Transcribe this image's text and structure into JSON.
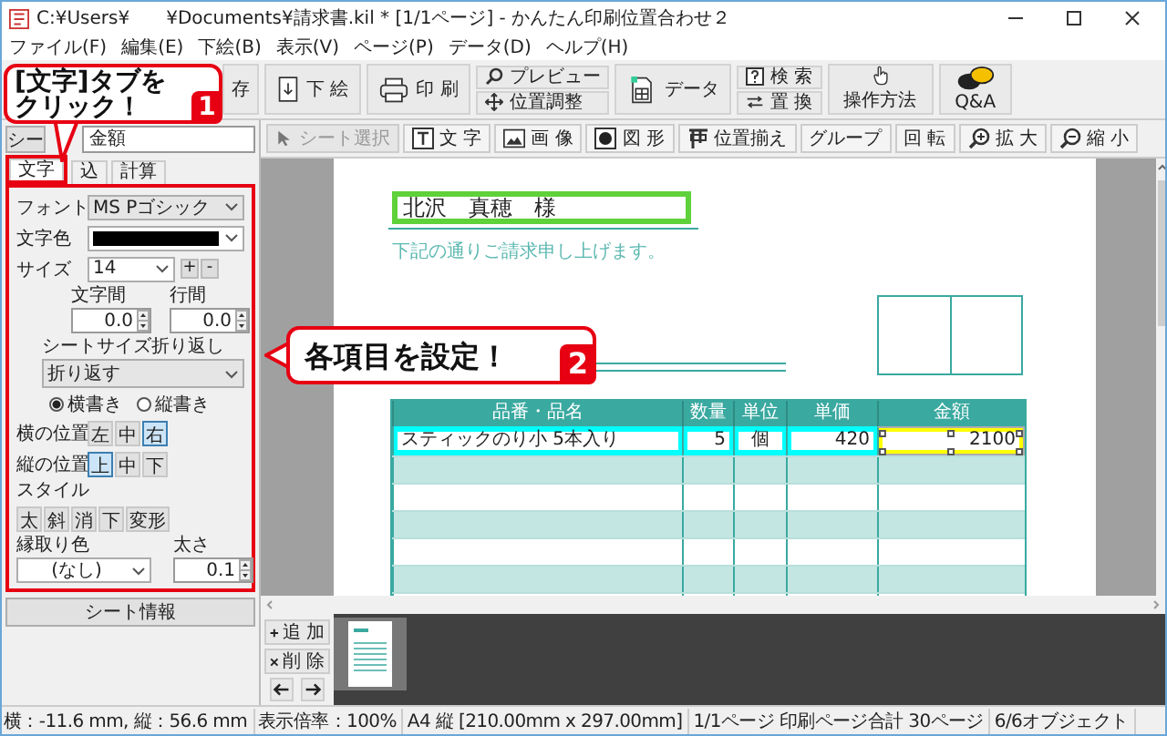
{
  "window": {
    "title": "C:¥Users¥　　¥Documents¥請求書.kil * [1/1ページ] - かんたん印刷位置合わせ２"
  },
  "menu": [
    "ファイル(F)",
    "編集(E)",
    "下絵(B)",
    "表示(V)",
    "ページ(P)",
    "データ(D)",
    "ヘルプ(H)"
  ],
  "toolbar": [
    {
      "kind": "cut",
      "label": "存"
    },
    {
      "kind": "big",
      "label": "下 絵"
    },
    {
      "kind": "big",
      "label": "印 刷"
    },
    {
      "kind": "stack",
      "items": [
        "プレビュー",
        "位置調整"
      ]
    },
    {
      "kind": "big",
      "label": "データ"
    },
    {
      "kind": "stack",
      "items": [
        "検 索",
        "置 換"
      ]
    },
    {
      "kind": "tall",
      "label": "操作方法"
    },
    {
      "kind": "tall",
      "label": "Q&A"
    }
  ],
  "object_toolbar": [
    {
      "label": "シート選択",
      "disabled": true
    },
    {
      "label": "文 字",
      "disabled": false
    },
    {
      "label": "画 像",
      "disabled": false
    },
    {
      "label": "図 形",
      "disabled": false
    },
    {
      "label": "位置揃え",
      "disabled": false
    },
    {
      "label": "グループ",
      "disabled": false
    },
    {
      "label": "回 転",
      "disabled": false
    },
    {
      "label": "拡 大",
      "disabled": false
    },
    {
      "label": "縮 小",
      "disabled": false
    }
  ],
  "left_panel": {
    "sheet_button": "シー",
    "name_field": "金額",
    "tabs": [
      {
        "label": "文字",
        "selected": true
      },
      {
        "label": "込",
        "selected": false
      },
      {
        "label": "計算",
        "selected": false
      }
    ],
    "font": {
      "label": "フォント",
      "value": "MS Pゴシック"
    },
    "text_color": {
      "label": "文字色"
    },
    "size": {
      "label": "サイズ",
      "value": "14",
      "buttons": [
        "+",
        "-"
      ]
    },
    "spacing": [
      {
        "label": "文字間",
        "value": "0.0"
      },
      {
        "label": "行間",
        "value": "0.0"
      }
    ],
    "wrap": {
      "label": "シートサイズ折り返し",
      "value": "折り返す"
    },
    "orientation": [
      {
        "label": "横書き",
        "selected": true
      },
      {
        "label": "縦書き",
        "selected": false
      }
    ],
    "alignment": [
      {
        "label": "横の位置",
        "options": [
          {
            "label": "左",
            "selected": false
          },
          {
            "label": "中",
            "selected": false
          },
          {
            "label": "右",
            "selected": true
          }
        ]
      },
      {
        "label": "縦の位置",
        "options": [
          {
            "label": "上",
            "selected": true
          },
          {
            "label": "中",
            "selected": false
          },
          {
            "label": "下",
            "selected": false
          }
        ]
      }
    ],
    "style": {
      "label": "スタイル",
      "buttons": [
        "太",
        "斜",
        "消",
        "下",
        "変形"
      ]
    },
    "outline": {
      "label": "縁取り色",
      "value": "(なし)"
    },
    "thickness": {
      "label": "太さ",
      "value": "0.1"
    },
    "sheet_info_button": "シート情報"
  },
  "document": {
    "recipient": "北沢　真穂　様",
    "note": "下記の通りご請求申し上げます。",
    "columns": [
      "品番・品名",
      "数量",
      "単位",
      "単価",
      "金額"
    ],
    "row": [
      {
        "text": "スティックのり小 5本入り",
        "selected": false
      },
      {
        "text": "5",
        "selected": false
      },
      {
        "text": "個",
        "selected": false
      },
      {
        "text": "420",
        "selected": false
      },
      {
        "text": "2100",
        "selected": true
      }
    ]
  },
  "pages": {
    "buttons": [
      "追 加",
      "削 除"
    ]
  },
  "callouts": [
    {
      "lines": [
        "[文字]タブを",
        "クリック！"
      ],
      "number": "1"
    },
    {
      "lines": [
        "各項目を設定！"
      ],
      "number": "2"
    }
  ],
  "status_bar": [
    "横：-11.6 mm, 縦：56.6 mm",
    "表示倍率：100%",
    "A4 縦 [210.00mm x 297.00mm]",
    "1/1ページ 印刷ページ合計 30ページ",
    "6/6オブジェクト"
  ]
}
